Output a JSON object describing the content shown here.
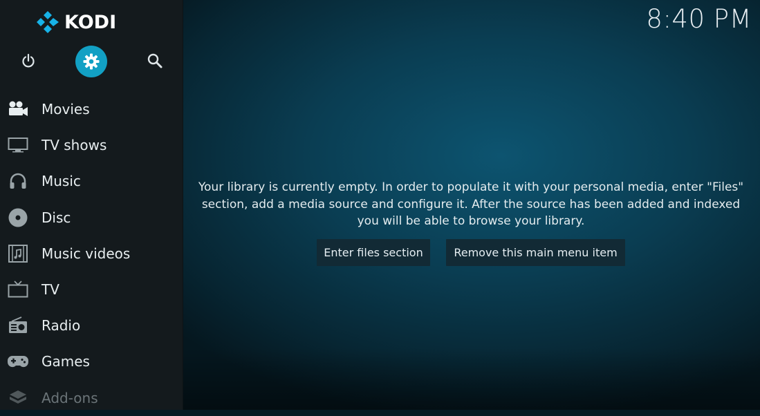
{
  "app": {
    "name": "KODI"
  },
  "clock": "8:40 PM",
  "top_icons": [
    {
      "name": "power-icon"
    },
    {
      "name": "settings-icon",
      "active": true,
      "accent": "#12a0c4"
    },
    {
      "name": "search-icon"
    }
  ],
  "menu": {
    "items": [
      {
        "label": "Movies",
        "icon": "movie-camera-icon"
      },
      {
        "label": "TV shows",
        "icon": "monitor-icon"
      },
      {
        "label": "Music",
        "icon": "headphones-icon"
      },
      {
        "label": "Disc",
        "icon": "disc-icon"
      },
      {
        "label": "Music videos",
        "icon": "film-music-icon"
      },
      {
        "label": "TV",
        "icon": "tv-icon"
      },
      {
        "label": "Radio",
        "icon": "radio-icon"
      },
      {
        "label": "Games",
        "icon": "gamepad-icon"
      },
      {
        "label": "Add-ons",
        "icon": "box-icon"
      }
    ]
  },
  "main": {
    "message": "Your library is currently empty. In order to populate it with your personal media, enter \"Files\" section, add a media source and configure it. After the source has been added and indexed you will be able to browse your library.",
    "buttons": {
      "enter_files": "Enter files section",
      "remove_item": "Remove this main menu item"
    }
  },
  "colors": {
    "accent": "#12a0c4",
    "logo_blue": "#17b2e7",
    "sidebar_bg": "#141a1d"
  }
}
